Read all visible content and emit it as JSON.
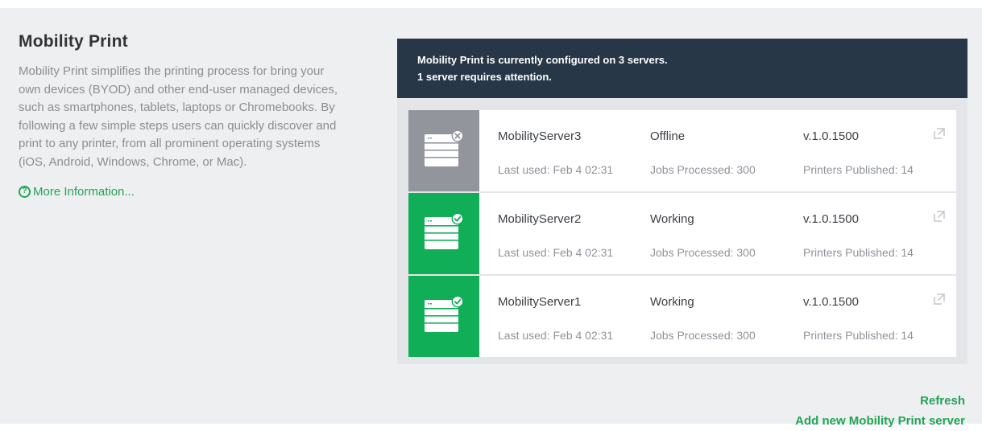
{
  "intro": {
    "title": "Mobility Print",
    "description": "Mobility Print simplifies the printing process for bring your own devices (BYOD) and other end-user managed devices, such as smartphones, tablets, laptops or Chromebooks. By following a few simple steps users can quickly discover and print to any printer, from all prominent operating systems (iOS, Android, Windows, Chrome, or Mac).",
    "more_info_icon": "?",
    "more_info_label": "More Information..."
  },
  "status_banner": {
    "line1": "Mobility Print is currently configured on 3 servers.",
    "line2": "1 server requires attention."
  },
  "servers": [
    {
      "name": "MobilityServer3",
      "status": "Offline",
      "version": "v.1.0.1500",
      "last_used": "Last used:  Feb 4 02:31",
      "jobs": "Jobs Processed:  300",
      "printers": "Printers Published:  14",
      "state_icon": "server-offline-icon"
    },
    {
      "name": "MobilityServer2",
      "status": "Working",
      "version": "v.1.0.1500",
      "last_used": "Last used:  Feb 4 02:31",
      "jobs": "Jobs Processed:  300",
      "printers": "Printers Published:  14",
      "state_icon": "server-ok-icon"
    },
    {
      "name": "MobilityServer1",
      "status": "Working",
      "version": "v.1.0.1500",
      "last_used": "Last used:  Feb 4 02:31",
      "jobs": "Jobs Processed:  300",
      "printers": "Printers Published:  14",
      "state_icon": "server-ok-icon"
    }
  ],
  "actions": {
    "refresh": "Refresh",
    "add_server": "Add new Mobility Print server"
  },
  "colors": {
    "accent": "#22a456",
    "banner": "#283747",
    "offline": "#92959c",
    "working": "#0fae57"
  }
}
